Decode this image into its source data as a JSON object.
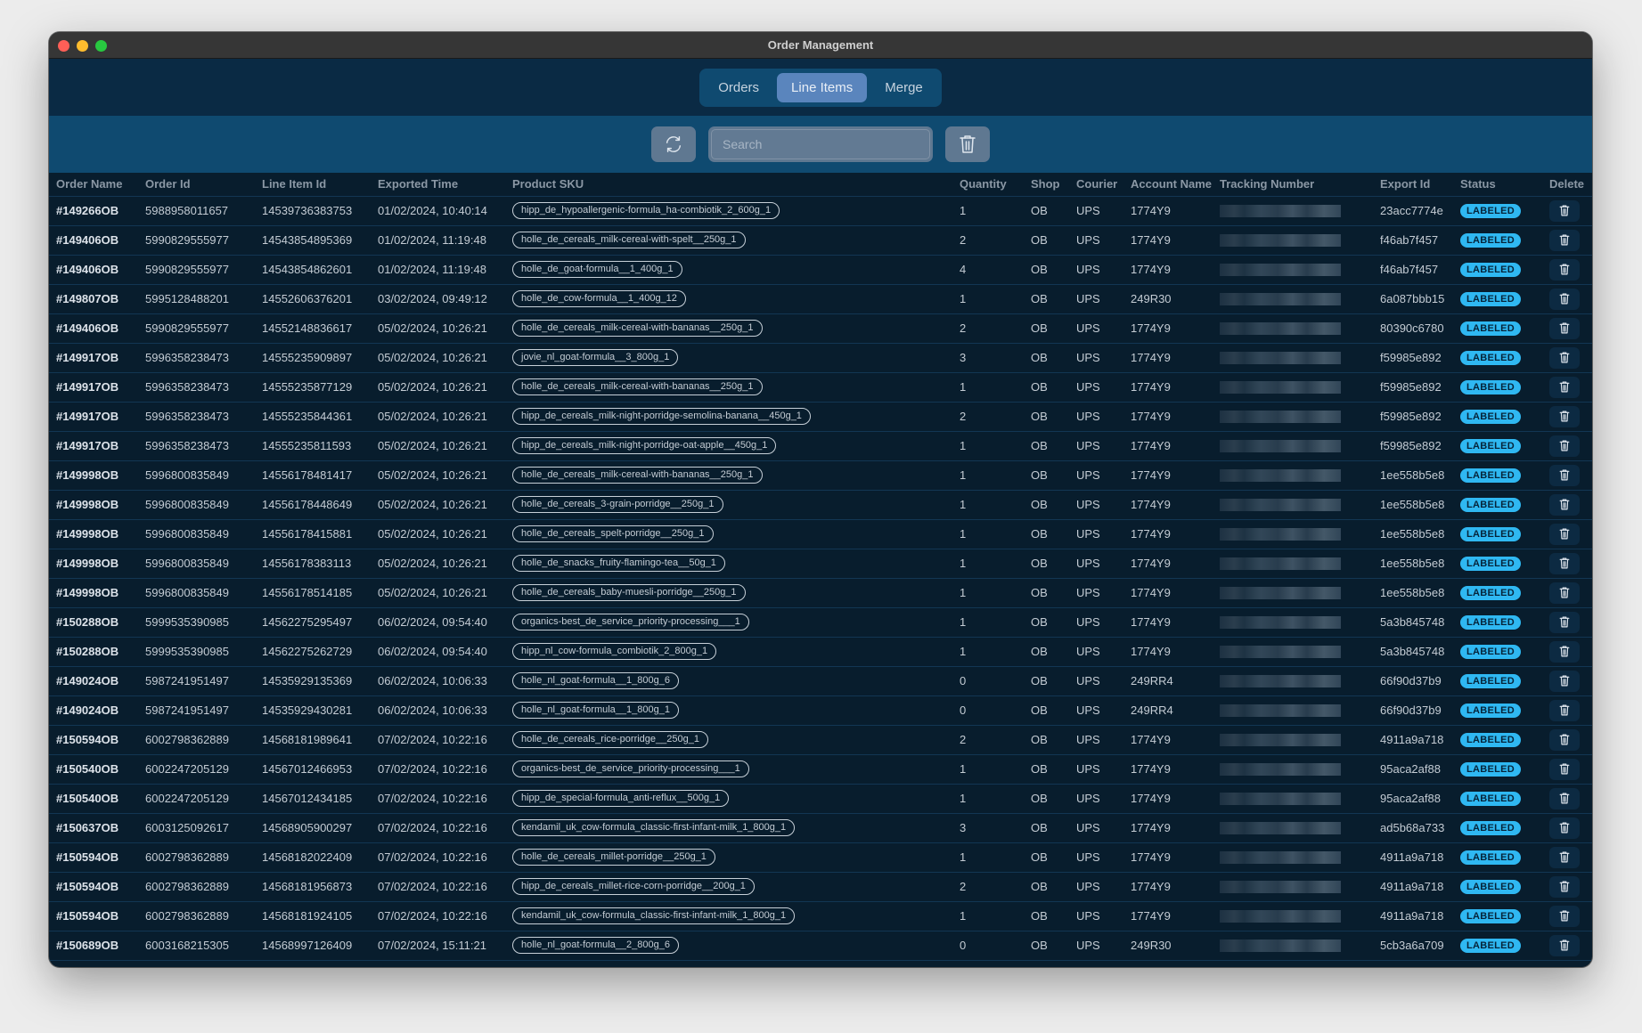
{
  "window": {
    "title": "Order Management"
  },
  "tabs": [
    {
      "label": "Orders",
      "active": false
    },
    {
      "label": "Line Items",
      "active": true
    },
    {
      "label": "Merge",
      "active": false
    }
  ],
  "toolbar": {
    "refresh_icon": "refresh-icon",
    "search_placeholder": "Search",
    "search_value": "",
    "delete_icon": "trash-icon"
  },
  "colors": {
    "accent": "#5a85bd",
    "status_labeled": "#2fb8f2",
    "background": "#081d2d",
    "toolbar": "#0f4a70"
  },
  "table": {
    "columns": [
      "Order Name",
      "Order Id",
      "Line Item Id",
      "Exported Time",
      "Product SKU",
      "Quantity",
      "Shop",
      "Courier",
      "Account Name",
      "Tracking Number",
      "Export Id",
      "Status",
      "Delete"
    ],
    "rows": [
      {
        "order_name": "#149266OB",
        "order_id": "5988958011657",
        "line_item_id": "14539736383753",
        "exported_time": "01/02/2024, 10:40:14",
        "sku": "hipp_de_hypoallergenic-formula_ha-combiotik_2_600g_1",
        "quantity": "1",
        "shop": "OB",
        "courier": "UPS",
        "account": "1774Y9",
        "export_id": "23acc7774e",
        "status": "LABELED"
      },
      {
        "order_name": "#149406OB",
        "order_id": "5990829555977",
        "line_item_id": "14543854895369",
        "exported_time": "01/02/2024, 11:19:48",
        "sku": "holle_de_cereals_milk-cereal-with-spelt__250g_1",
        "quantity": "2",
        "shop": "OB",
        "courier": "UPS",
        "account": "1774Y9",
        "export_id": "f46ab7f457",
        "status": "LABELED"
      },
      {
        "order_name": "#149406OB",
        "order_id": "5990829555977",
        "line_item_id": "14543854862601",
        "exported_time": "01/02/2024, 11:19:48",
        "sku": "holle_de_goat-formula__1_400g_1",
        "quantity": "4",
        "shop": "OB",
        "courier": "UPS",
        "account": "1774Y9",
        "export_id": "f46ab7f457",
        "status": "LABELED"
      },
      {
        "order_name": "#149807OB",
        "order_id": "5995128488201",
        "line_item_id": "14552606376201",
        "exported_time": "03/02/2024, 09:49:12",
        "sku": "holle_de_cow-formula__1_400g_12",
        "quantity": "1",
        "shop": "OB",
        "courier": "UPS",
        "account": "249R30",
        "export_id": "6a087bbb15",
        "status": "LABELED"
      },
      {
        "order_name": "#149406OB",
        "order_id": "5990829555977",
        "line_item_id": "14552148836617",
        "exported_time": "05/02/2024, 10:26:21",
        "sku": "holle_de_cereals_milk-cereal-with-bananas__250g_1",
        "quantity": "2",
        "shop": "OB",
        "courier": "UPS",
        "account": "1774Y9",
        "export_id": "80390c6780",
        "status": "LABELED"
      },
      {
        "order_name": "#149917OB",
        "order_id": "5996358238473",
        "line_item_id": "14555235909897",
        "exported_time": "05/02/2024, 10:26:21",
        "sku": "jovie_nl_goat-formula__3_800g_1",
        "quantity": "3",
        "shop": "OB",
        "courier": "UPS",
        "account": "1774Y9",
        "export_id": "f59985e892",
        "status": "LABELED"
      },
      {
        "order_name": "#149917OB",
        "order_id": "5996358238473",
        "line_item_id": "14555235877129",
        "exported_time": "05/02/2024, 10:26:21",
        "sku": "holle_de_cereals_milk-cereal-with-bananas__250g_1",
        "quantity": "1",
        "shop": "OB",
        "courier": "UPS",
        "account": "1774Y9",
        "export_id": "f59985e892",
        "status": "LABELED"
      },
      {
        "order_name": "#149917OB",
        "order_id": "5996358238473",
        "line_item_id": "14555235844361",
        "exported_time": "05/02/2024, 10:26:21",
        "sku": "hipp_de_cereals_milk-night-porridge-semolina-banana__450g_1",
        "quantity": "2",
        "shop": "OB",
        "courier": "UPS",
        "account": "1774Y9",
        "export_id": "f59985e892",
        "status": "LABELED"
      },
      {
        "order_name": "#149917OB",
        "order_id": "5996358238473",
        "line_item_id": "14555235811593",
        "exported_time": "05/02/2024, 10:26:21",
        "sku": "hipp_de_cereals_milk-night-porridge-oat-apple__450g_1",
        "quantity": "1",
        "shop": "OB",
        "courier": "UPS",
        "account": "1774Y9",
        "export_id": "f59985e892",
        "status": "LABELED"
      },
      {
        "order_name": "#149998OB",
        "order_id": "5996800835849",
        "line_item_id": "14556178481417",
        "exported_time": "05/02/2024, 10:26:21",
        "sku": "holle_de_cereals_milk-cereal-with-bananas__250g_1",
        "quantity": "1",
        "shop": "OB",
        "courier": "UPS",
        "account": "1774Y9",
        "export_id": "1ee558b5e8",
        "status": "LABELED"
      },
      {
        "order_name": "#149998OB",
        "order_id": "5996800835849",
        "line_item_id": "14556178448649",
        "exported_time": "05/02/2024, 10:26:21",
        "sku": "holle_de_cereals_3-grain-porridge__250g_1",
        "quantity": "1",
        "shop": "OB",
        "courier": "UPS",
        "account": "1774Y9",
        "export_id": "1ee558b5e8",
        "status": "LABELED"
      },
      {
        "order_name": "#149998OB",
        "order_id": "5996800835849",
        "line_item_id": "14556178415881",
        "exported_time": "05/02/2024, 10:26:21",
        "sku": "holle_de_cereals_spelt-porridge__250g_1",
        "quantity": "1",
        "shop": "OB",
        "courier": "UPS",
        "account": "1774Y9",
        "export_id": "1ee558b5e8",
        "status": "LABELED"
      },
      {
        "order_name": "#149998OB",
        "order_id": "5996800835849",
        "line_item_id": "14556178383113",
        "exported_time": "05/02/2024, 10:26:21",
        "sku": "holle_de_snacks_fruity-flamingo-tea__50g_1",
        "quantity": "1",
        "shop": "OB",
        "courier": "UPS",
        "account": "1774Y9",
        "export_id": "1ee558b5e8",
        "status": "LABELED"
      },
      {
        "order_name": "#149998OB",
        "order_id": "5996800835849",
        "line_item_id": "14556178514185",
        "exported_time": "05/02/2024, 10:26:21",
        "sku": "holle_de_cereals_baby-muesli-porridge__250g_1",
        "quantity": "1",
        "shop": "OB",
        "courier": "UPS",
        "account": "1774Y9",
        "export_id": "1ee558b5e8",
        "status": "LABELED"
      },
      {
        "order_name": "#150288OB",
        "order_id": "5999535390985",
        "line_item_id": "14562275295497",
        "exported_time": "06/02/2024, 09:54:40",
        "sku": "organics-best_de_service_priority-processing___1",
        "quantity": "1",
        "shop": "OB",
        "courier": "UPS",
        "account": "1774Y9",
        "export_id": "5a3b845748",
        "status": "LABELED"
      },
      {
        "order_name": "#150288OB",
        "order_id": "5999535390985",
        "line_item_id": "14562275262729",
        "exported_time": "06/02/2024, 09:54:40",
        "sku": "hipp_nl_cow-formula_combiotik_2_800g_1",
        "quantity": "1",
        "shop": "OB",
        "courier": "UPS",
        "account": "1774Y9",
        "export_id": "5a3b845748",
        "status": "LABELED"
      },
      {
        "order_name": "#149024OB",
        "order_id": "5987241951497",
        "line_item_id": "14535929135369",
        "exported_time": "06/02/2024, 10:06:33",
        "sku": "holle_nl_goat-formula__1_800g_6",
        "quantity": "0",
        "shop": "OB",
        "courier": "UPS",
        "account": "249RR4",
        "export_id": "66f90d37b9",
        "status": "LABELED"
      },
      {
        "order_name": "#149024OB",
        "order_id": "5987241951497",
        "line_item_id": "14535929430281",
        "exported_time": "06/02/2024, 10:06:33",
        "sku": "holle_nl_goat-formula__1_800g_1",
        "quantity": "0",
        "shop": "OB",
        "courier": "UPS",
        "account": "249RR4",
        "export_id": "66f90d37b9",
        "status": "LABELED"
      },
      {
        "order_name": "#150594OB",
        "order_id": "6002798362889",
        "line_item_id": "14568181989641",
        "exported_time": "07/02/2024, 10:22:16",
        "sku": "holle_de_cereals_rice-porridge__250g_1",
        "quantity": "2",
        "shop": "OB",
        "courier": "UPS",
        "account": "1774Y9",
        "export_id": "4911a9a718",
        "status": "LABELED"
      },
      {
        "order_name": "#150540OB",
        "order_id": "6002247205129",
        "line_item_id": "14567012466953",
        "exported_time": "07/02/2024, 10:22:16",
        "sku": "organics-best_de_service_priority-processing___1",
        "quantity": "1",
        "shop": "OB",
        "courier": "UPS",
        "account": "1774Y9",
        "export_id": "95aca2af88",
        "status": "LABELED"
      },
      {
        "order_name": "#150540OB",
        "order_id": "6002247205129",
        "line_item_id": "14567012434185",
        "exported_time": "07/02/2024, 10:22:16",
        "sku": "hipp_de_special-formula_anti-reflux__500g_1",
        "quantity": "1",
        "shop": "OB",
        "courier": "UPS",
        "account": "1774Y9",
        "export_id": "95aca2af88",
        "status": "LABELED"
      },
      {
        "order_name": "#150637OB",
        "order_id": "6003125092617",
        "line_item_id": "14568905900297",
        "exported_time": "07/02/2024, 10:22:16",
        "sku": "kendamil_uk_cow-formula_classic-first-infant-milk_1_800g_1",
        "quantity": "3",
        "shop": "OB",
        "courier": "UPS",
        "account": "1774Y9",
        "export_id": "ad5b68a733",
        "status": "LABELED"
      },
      {
        "order_name": "#150594OB",
        "order_id": "6002798362889",
        "line_item_id": "14568182022409",
        "exported_time": "07/02/2024, 10:22:16",
        "sku": "holle_de_cereals_millet-porridge__250g_1",
        "quantity": "1",
        "shop": "OB",
        "courier": "UPS",
        "account": "1774Y9",
        "export_id": "4911a9a718",
        "status": "LABELED"
      },
      {
        "order_name": "#150594OB",
        "order_id": "6002798362889",
        "line_item_id": "14568181956873",
        "exported_time": "07/02/2024, 10:22:16",
        "sku": "hipp_de_cereals_millet-rice-corn-porridge__200g_1",
        "quantity": "2",
        "shop": "OB",
        "courier": "UPS",
        "account": "1774Y9",
        "export_id": "4911a9a718",
        "status": "LABELED"
      },
      {
        "order_name": "#150594OB",
        "order_id": "6002798362889",
        "line_item_id": "14568181924105",
        "exported_time": "07/02/2024, 10:22:16",
        "sku": "kendamil_uk_cow-formula_classic-first-infant-milk_1_800g_1",
        "quantity": "1",
        "shop": "OB",
        "courier": "UPS",
        "account": "1774Y9",
        "export_id": "4911a9a718",
        "status": "LABELED"
      },
      {
        "order_name": "#150689OB",
        "order_id": "6003168215305",
        "line_item_id": "14568997126409",
        "exported_time": "07/02/2024, 15:11:21",
        "sku": "holle_nl_goat-formula__2_800g_6",
        "quantity": "0",
        "shop": "OB",
        "courier": "UPS",
        "account": "249R30",
        "export_id": "5cb3a6a709",
        "status": "LABELED"
      }
    ]
  }
}
